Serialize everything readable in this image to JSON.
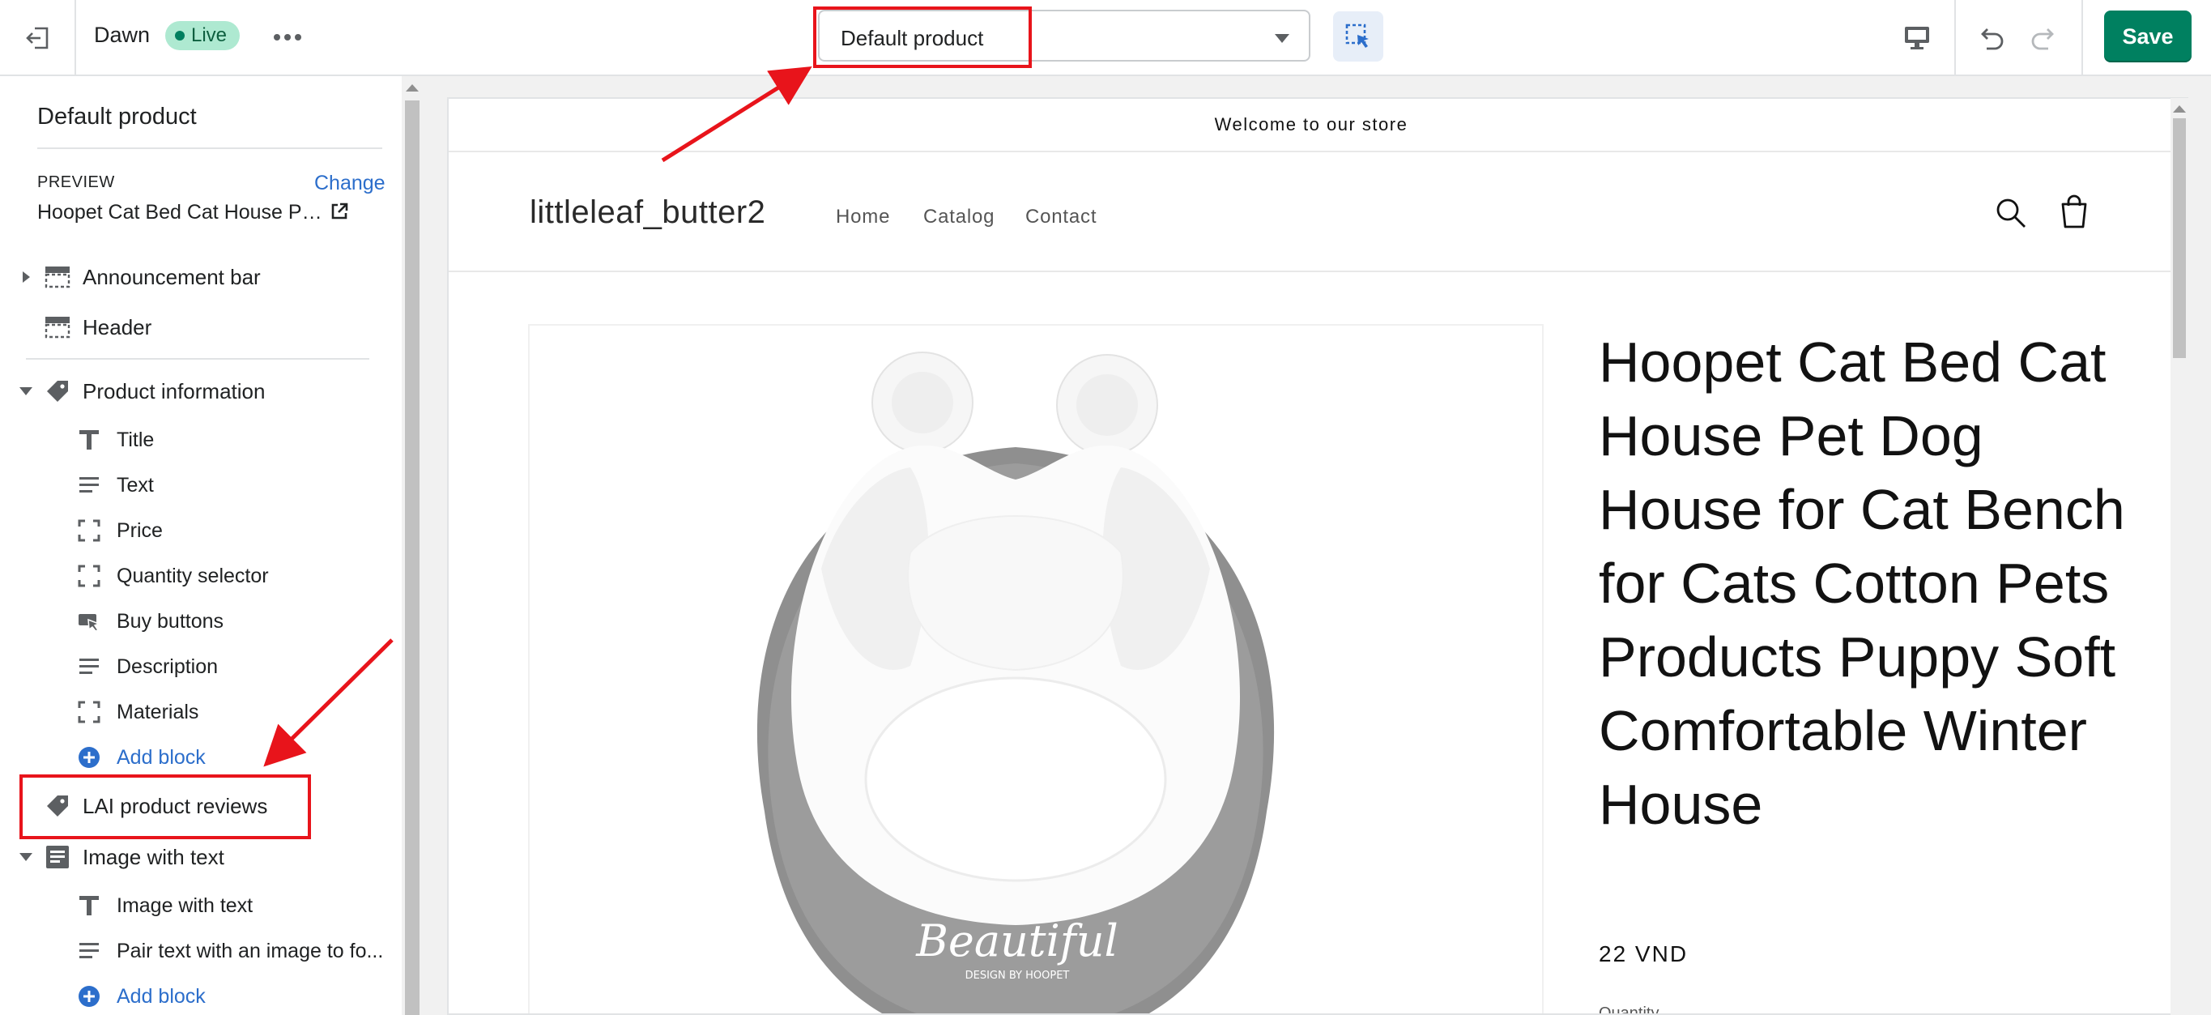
{
  "topbar": {
    "theme_name": "Dawn",
    "live_badge": "Live",
    "template_select": "Default product",
    "save_label": "Save",
    "icons": {
      "exit": "exit-icon",
      "more": "more-horizontal-icon",
      "inspector": "inspector-select-icon",
      "device": "desktop-icon",
      "undo": "undo-icon",
      "redo": "redo-icon"
    },
    "colors": {
      "save_bg": "#008060",
      "live_bg": "#aee9d1",
      "inspector_bg": "#e7eef8"
    }
  },
  "sidebar": {
    "title": "Default product",
    "preview_label": "PREVIEW",
    "preview_change": "Change",
    "preview_value": "Hoopet Cat Bed Cat House Pe...",
    "sections": {
      "announcement_bar": "Announcement bar",
      "header": "Header",
      "product_information": "Product information",
      "lai_reviews": "LAI product reviews",
      "image_with_text": "Image with text"
    },
    "product_blocks": [
      "Title",
      "Text",
      "Price",
      "Quantity selector",
      "Buy buttons",
      "Description",
      "Materials"
    ],
    "image_text_blocks": [
      "Image with text",
      "Pair text with an image to fo..."
    ],
    "add_block": "Add block"
  },
  "preview": {
    "announcement": "Welcome to our store",
    "store_name": "littleleaf_butter2",
    "nav": [
      "Home",
      "Catalog",
      "Contact"
    ],
    "product_title": "Hoopet Cat Bed Cat House Pet Dog House for Cat Bench for Cats Cotton Pets Products Puppy Soft Comfortable Winter House",
    "price": "22 VND",
    "quantity_label": "Quantity",
    "image_text": "Beautiful",
    "image_subtext": "DESIGN BY HOOPET"
  },
  "annotations": {
    "color": "#e8141b"
  }
}
